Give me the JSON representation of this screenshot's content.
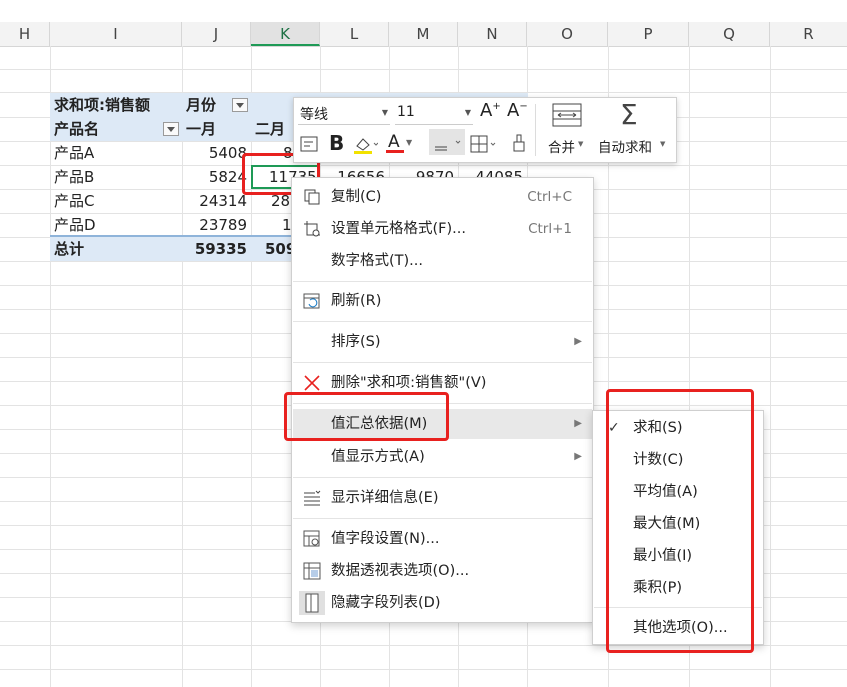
{
  "columns": [
    "H",
    "I",
    "J",
    "K",
    "L",
    "M",
    "N",
    "O",
    "P",
    "Q",
    "R"
  ],
  "selected_column": "K",
  "pivot": {
    "header_value_field": "求和项:销售额",
    "header_col_field": "月份",
    "row_label": "产品名",
    "month1": "一月",
    "month2": "二月",
    "rows": [
      {
        "name": "产品A",
        "v1": "5408",
        "v2": "8("
      },
      {
        "name": "产品B",
        "v1": "5824",
        "v2": "11735",
        "v3": "16656",
        "v4": "9870",
        "v5": "44085"
      },
      {
        "name": "产品C",
        "v1": "24314",
        "v2": "28"
      },
      {
        "name": "产品D",
        "v1": "23789",
        "v2": "1"
      }
    ],
    "total_label": "总计",
    "total_v1": "59335",
    "total_v2": "509"
  },
  "toolbar": {
    "font_name": "等线",
    "font_size": "11",
    "merge_label": "合并",
    "autosum_label": "自动求和"
  },
  "context_menu": {
    "items": [
      {
        "label": "复制(C)",
        "shortcut": "Ctrl+C"
      },
      {
        "label": "设置单元格格式(F)...",
        "shortcut": "Ctrl+1"
      },
      {
        "label": "数字格式(T)..."
      },
      {
        "label": "刷新(R)"
      },
      {
        "label": "排序(S)"
      },
      {
        "label": "删除\"求和项:销售额\"(V)"
      },
      {
        "label": "值汇总依据(M)"
      },
      {
        "label": "值显示方式(A)"
      },
      {
        "label": "显示详细信息(E)"
      },
      {
        "label": "值字段设置(N)..."
      },
      {
        "label": "数据透视表选项(O)..."
      },
      {
        "label": "隐藏字段列表(D)"
      }
    ]
  },
  "submenu": {
    "items": [
      {
        "label": "求和(S)",
        "checked": true
      },
      {
        "label": "计数(C)"
      },
      {
        "label": "平均值(A)"
      },
      {
        "label": "最大值(M)"
      },
      {
        "label": "最小值(I)"
      },
      {
        "label": "乘积(P)"
      },
      {
        "label": "其他选项(O)..."
      }
    ],
    "check_mark": "✓"
  },
  "colors": {
    "highlight_red": "#e8211f",
    "pivot_header_bg": "#dde9f6",
    "selection_green": "#1e9a56"
  }
}
